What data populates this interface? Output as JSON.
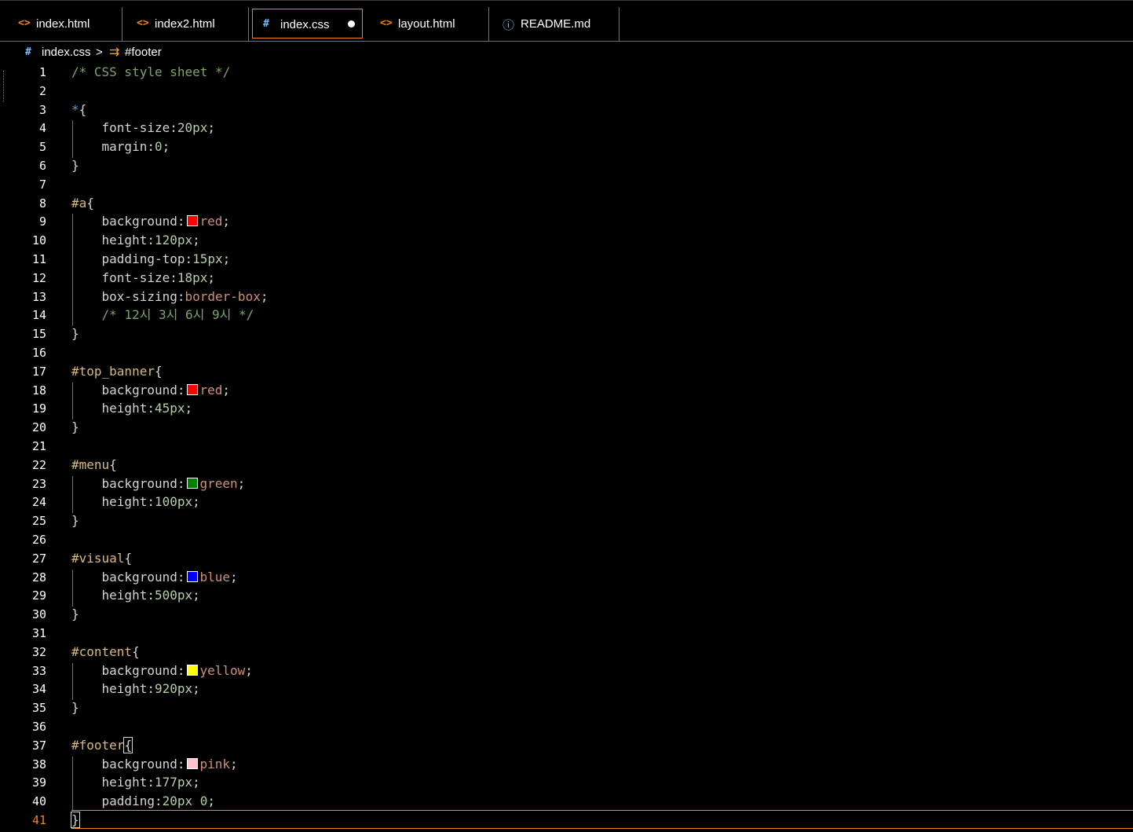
{
  "tabs": [
    {
      "icon": "<>",
      "label": "index.html",
      "icon_color": "#f38518"
    },
    {
      "icon": "<>",
      "label": "index2.html",
      "icon_color": "#f38518"
    },
    {
      "icon": "#",
      "label": "index.css",
      "icon_color": "#75beff",
      "modified": true
    },
    {
      "icon": "<>",
      "label": "layout.html",
      "icon_color": "#f38518"
    },
    {
      "icon": "ⓘ",
      "label": "README.md",
      "icon_color": "#75beff"
    }
  ],
  "breadcrumb": {
    "file": "index.css",
    "separator": ">",
    "symbol": "#footer",
    "file_icon": "#",
    "symbol_icon": "⇉"
  },
  "current_line": 41,
  "colors": {
    "accent": "#f38518",
    "red": "#ff0000",
    "green": "#008000",
    "blue": "#0000ff",
    "yellow": "#ffff00",
    "pink": "#ffc0cb"
  },
  "lines": [
    "/* CSS style sheet */",
    "",
    "*{",
    "    font-size:20px;",
    "    margin:0;",
    "}",
    "",
    "#a{",
    "    background:red;",
    "    height:120px;",
    "    padding-top:15px;",
    "    font-size:18px;",
    "    box-sizing:border-box;",
    "    /* 12시 3시 6시 9시 */",
    "}",
    "",
    "#top_banner{",
    "    background:red;",
    "    height:45px;",
    "}",
    "",
    "#menu{",
    "    background:green;",
    "    height:100px;",
    "}",
    "",
    "#visual{",
    "    background:blue;",
    "    height:500px;",
    "}",
    "",
    "#content{",
    "    background:yellow;",
    "    height:920px;",
    "}",
    "",
    "#footer{",
    "    background:pink;",
    "    height:177px;",
    "    padding:20px 0;",
    "}"
  ]
}
